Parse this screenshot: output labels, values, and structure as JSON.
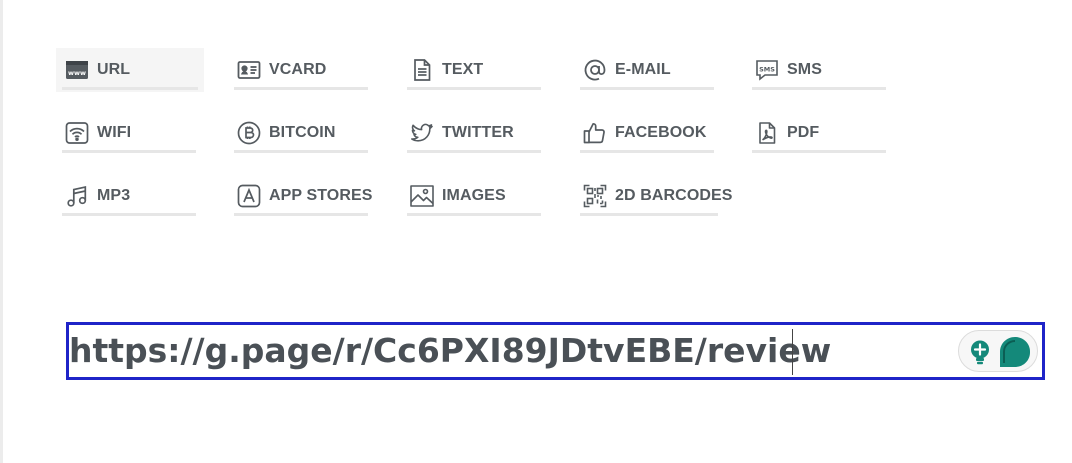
{
  "tabs": [
    {
      "id": "url",
      "label": "URL",
      "icon": "www-browser-icon",
      "active": true
    },
    {
      "id": "vcard",
      "label": "VCARD",
      "icon": "contact-card-icon",
      "active": false
    },
    {
      "id": "text",
      "label": "TEXT",
      "icon": "document-icon",
      "active": false
    },
    {
      "id": "email",
      "label": "E-MAIL",
      "icon": "at-sign-icon",
      "active": false
    },
    {
      "id": "sms",
      "label": "SMS",
      "icon": "sms-bubble-icon",
      "active": false
    },
    {
      "id": "wifi",
      "label": "WIFI",
      "icon": "wifi-icon",
      "active": false
    },
    {
      "id": "bitcoin",
      "label": "BITCOIN",
      "icon": "bitcoin-icon",
      "active": false
    },
    {
      "id": "twitter",
      "label": "TWITTER",
      "icon": "twitter-bird-icon",
      "active": false
    },
    {
      "id": "facebook",
      "label": "FACEBOOK",
      "icon": "thumbs-up-icon",
      "active": false
    },
    {
      "id": "pdf",
      "label": "PDF",
      "icon": "pdf-file-icon",
      "active": false
    },
    {
      "id": "mp3",
      "label": "MP3",
      "icon": "music-note-icon",
      "active": false
    },
    {
      "id": "app_stores",
      "label": "APP STORES",
      "icon": "app-store-icon",
      "active": false
    },
    {
      "id": "images",
      "label": "IMAGES",
      "icon": "image-icon",
      "active": false
    },
    {
      "id": "barcodes_2d",
      "label": "2D BARCODES",
      "icon": "barcode-scan-icon",
      "active": false
    }
  ],
  "url_input": {
    "value": "https://g.page/r/Cc6PXI89JDtvEBE/review"
  },
  "extension": {
    "bulb_icon": "lightbulb-icon",
    "chat_icon": "chat-bubble-icon"
  },
  "colors": {
    "text": "#555b60",
    "focus_border": "#1f24c8",
    "extension_green": "#14897a",
    "tab_underline": "#e6e6e6"
  }
}
